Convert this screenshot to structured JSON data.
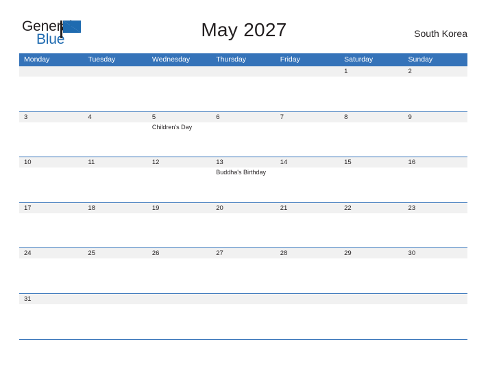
{
  "brand": {
    "name_part1": "General",
    "name_part2": "Blue",
    "flag_icon": "flag-triangle-icon",
    "primary_color": "#1f6bb0",
    "header_color": "#3573b9",
    "date_band_color": "#f1f1f1"
  },
  "header": {
    "title": "May 2027",
    "country": "South Korea"
  },
  "calendar": {
    "weekdays": [
      "Monday",
      "Tuesday",
      "Wednesday",
      "Thursday",
      "Friday",
      "Saturday",
      "Sunday"
    ],
    "weeks": [
      {
        "days": [
          {
            "date": "",
            "event": ""
          },
          {
            "date": "",
            "event": ""
          },
          {
            "date": "",
            "event": ""
          },
          {
            "date": "",
            "event": ""
          },
          {
            "date": "",
            "event": ""
          },
          {
            "date": "1",
            "event": ""
          },
          {
            "date": "2",
            "event": ""
          }
        ]
      },
      {
        "days": [
          {
            "date": "3",
            "event": ""
          },
          {
            "date": "4",
            "event": ""
          },
          {
            "date": "5",
            "event": "Children's Day"
          },
          {
            "date": "6",
            "event": ""
          },
          {
            "date": "7",
            "event": ""
          },
          {
            "date": "8",
            "event": ""
          },
          {
            "date": "9",
            "event": ""
          }
        ]
      },
      {
        "days": [
          {
            "date": "10",
            "event": ""
          },
          {
            "date": "11",
            "event": ""
          },
          {
            "date": "12",
            "event": ""
          },
          {
            "date": "13",
            "event": "Buddha's Birthday"
          },
          {
            "date": "14",
            "event": ""
          },
          {
            "date": "15",
            "event": ""
          },
          {
            "date": "16",
            "event": ""
          }
        ]
      },
      {
        "days": [
          {
            "date": "17",
            "event": ""
          },
          {
            "date": "18",
            "event": ""
          },
          {
            "date": "19",
            "event": ""
          },
          {
            "date": "20",
            "event": ""
          },
          {
            "date": "21",
            "event": ""
          },
          {
            "date": "22",
            "event": ""
          },
          {
            "date": "23",
            "event": ""
          }
        ]
      },
      {
        "days": [
          {
            "date": "24",
            "event": ""
          },
          {
            "date": "25",
            "event": ""
          },
          {
            "date": "26",
            "event": ""
          },
          {
            "date": "27",
            "event": ""
          },
          {
            "date": "28",
            "event": ""
          },
          {
            "date": "29",
            "event": ""
          },
          {
            "date": "30",
            "event": ""
          }
        ]
      },
      {
        "days": [
          {
            "date": "31",
            "event": ""
          },
          {
            "date": "",
            "event": ""
          },
          {
            "date": "",
            "event": ""
          },
          {
            "date": "",
            "event": ""
          },
          {
            "date": "",
            "event": ""
          },
          {
            "date": "",
            "event": ""
          },
          {
            "date": "",
            "event": ""
          }
        ]
      }
    ]
  }
}
